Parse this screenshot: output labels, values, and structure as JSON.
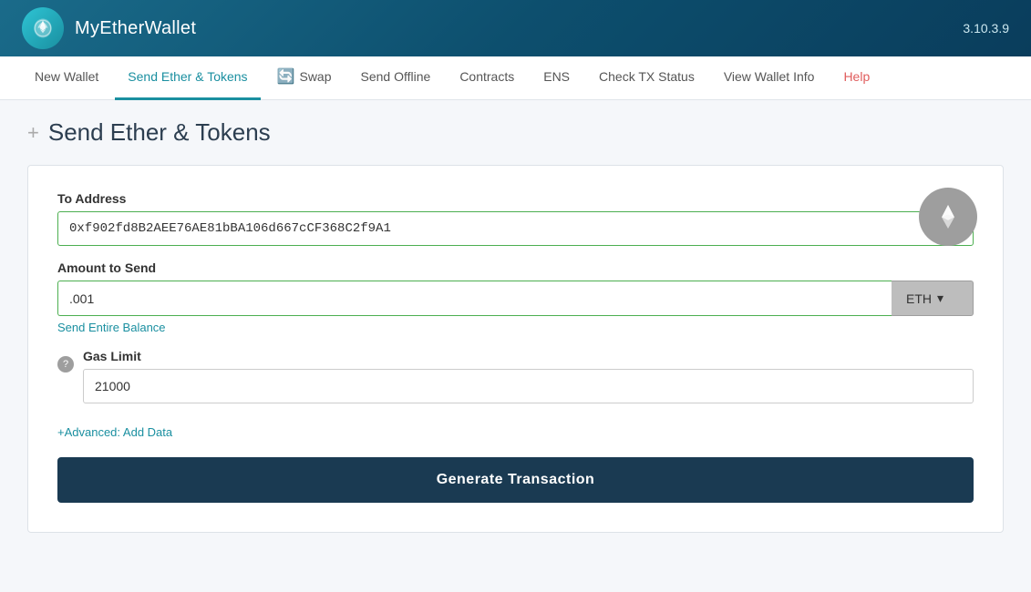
{
  "header": {
    "app_name": "MyEtherWallet",
    "version": "3.10.3.9"
  },
  "nav": {
    "items": [
      {
        "id": "new-wallet",
        "label": "New Wallet",
        "active": false
      },
      {
        "id": "send-ether",
        "label": "Send Ether & Tokens",
        "active": true
      },
      {
        "id": "swap",
        "label": "Swap",
        "active": false,
        "has_icon": true
      },
      {
        "id": "send-offline",
        "label": "Send Offline",
        "active": false
      },
      {
        "id": "contracts",
        "label": "Contracts",
        "active": false
      },
      {
        "id": "ens",
        "label": "ENS",
        "active": false
      },
      {
        "id": "check-tx",
        "label": "Check TX Status",
        "active": false
      },
      {
        "id": "view-wallet",
        "label": "View Wallet Info",
        "active": false
      },
      {
        "id": "help",
        "label": "Help",
        "active": false
      }
    ]
  },
  "page": {
    "plus": "+",
    "title": "Send Ether & Tokens"
  },
  "form": {
    "to_address_label": "To Address",
    "to_address_value": "0xf902fd8B2AEE76AE81bBA106d667cCF368C2f9A1",
    "amount_label": "Amount to Send",
    "amount_value": ".001",
    "token_label": "ETH",
    "token_dropdown_icon": "▾",
    "send_balance_link": "Send Entire Balance",
    "gas_limit_label": "Gas Limit",
    "gas_limit_value": "21000",
    "advanced_link": "+Advanced: Add Data",
    "generate_btn": "Generate Transaction",
    "help_icon": "?"
  }
}
